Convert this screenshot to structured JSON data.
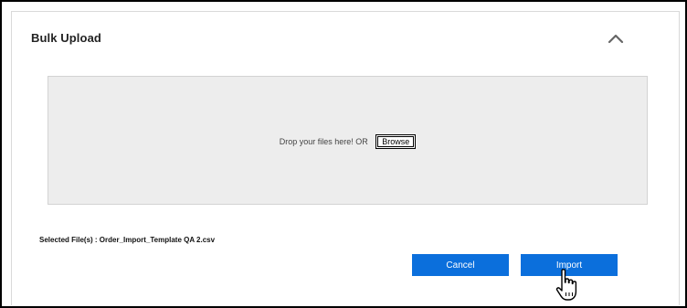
{
  "panel": {
    "title": "Bulk Upload",
    "collapse_icon": "chevron-up-icon"
  },
  "dropzone": {
    "text": "Drop your files here! OR",
    "browse_label": "Browse"
  },
  "selected_files": {
    "text": "Selected File(s) : Order_Import_Template QA 2.csv"
  },
  "actions": {
    "cancel_label": "Cancel",
    "import_label": "Import"
  },
  "colors": {
    "primary": "#0b6fdc",
    "dropzone_bg": "#ededed"
  }
}
